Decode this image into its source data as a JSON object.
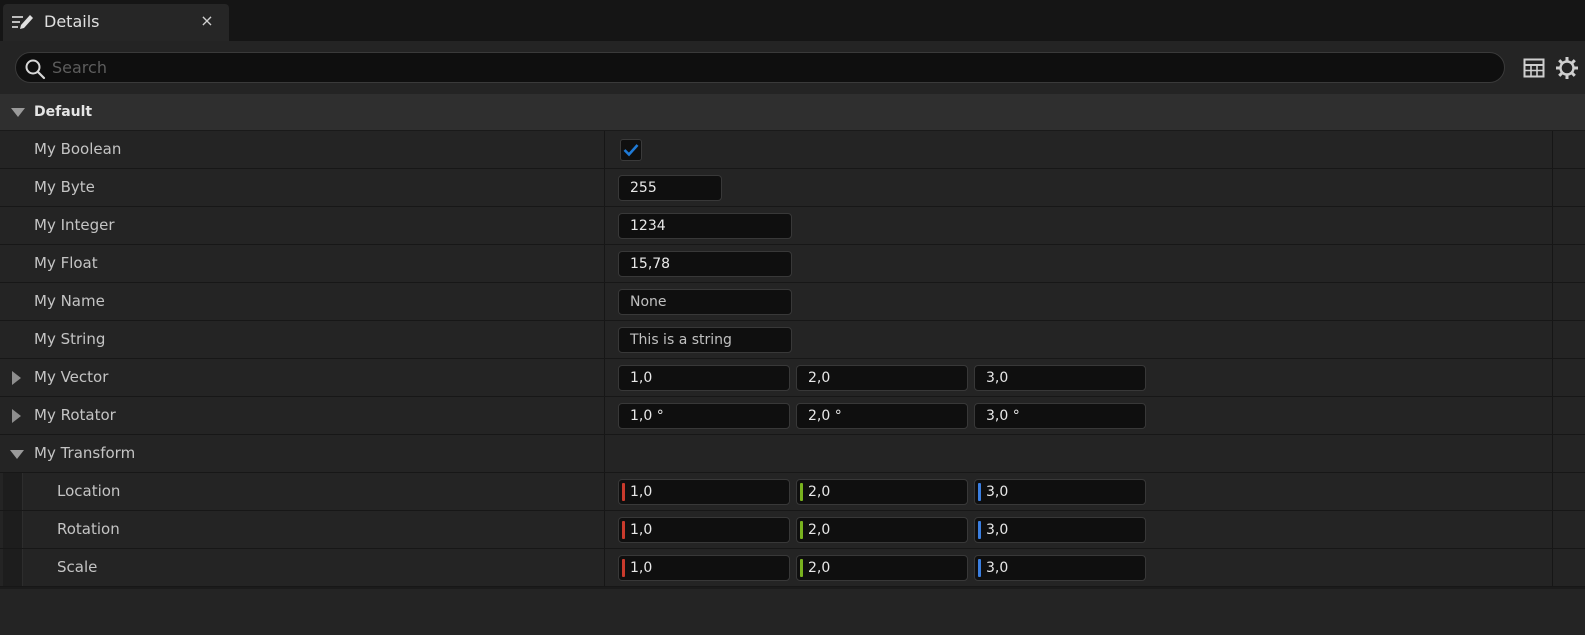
{
  "tab": {
    "title": "Details",
    "close": "×"
  },
  "search": {
    "placeholder": "Search",
    "value": ""
  },
  "category": {
    "label": "Default"
  },
  "colors": {
    "axis_x": "#c93a2c",
    "axis_y": "#78b21e",
    "axis_z": "#3a7ee0",
    "check": "#1f7ad6"
  },
  "properties": {
    "boolean": {
      "label": "My Boolean",
      "checked": true
    },
    "byte": {
      "label": "My Byte",
      "value": "255"
    },
    "integer": {
      "label": "My Integer",
      "value": "1234"
    },
    "float": {
      "label": "My Float",
      "value": "15,78"
    },
    "name": {
      "label": "My Name",
      "value": "None"
    },
    "string": {
      "label": "My String",
      "value": "This is a string"
    },
    "vector": {
      "label": "My Vector",
      "x": "1,0",
      "y": "2,0",
      "z": "3,0"
    },
    "rotator": {
      "label": "My Rotator",
      "x": "1,0 °",
      "y": "2,0 °",
      "z": "3,0 °"
    },
    "transform": {
      "label": "My Transform",
      "location": {
        "label": "Location",
        "x": "1,0",
        "y": "2,0",
        "z": "3,0"
      },
      "rotation": {
        "label": "Rotation",
        "x": "1,0",
        "y": "2,0",
        "z": "3,0"
      },
      "scale": {
        "label": "Scale",
        "x": "1,0",
        "y": "2,0",
        "z": "3,0"
      }
    }
  }
}
